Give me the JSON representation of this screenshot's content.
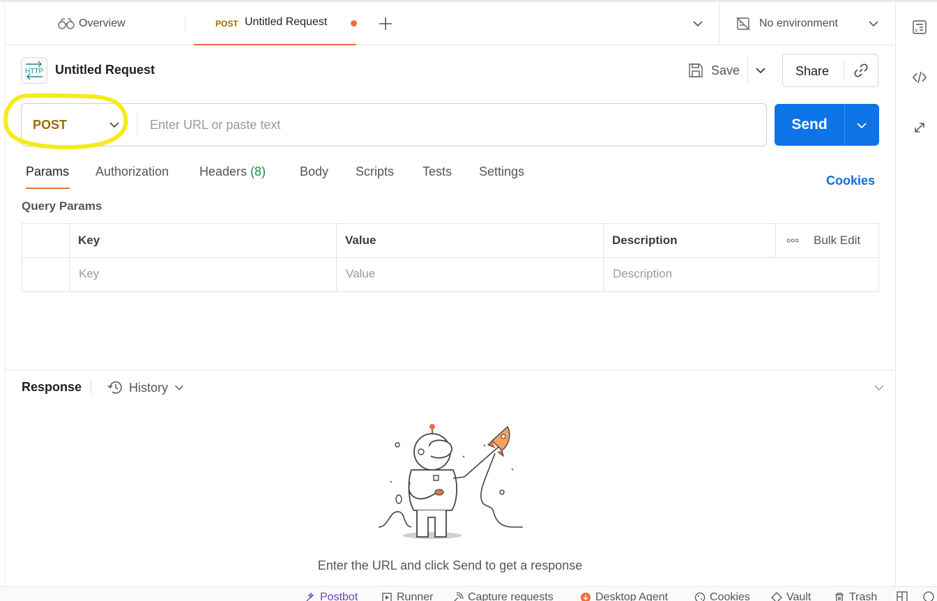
{
  "tabs": {
    "overview_label": "Overview",
    "active": {
      "method": "POST",
      "title": "Untitled Request"
    }
  },
  "environment": {
    "label": "No environment"
  },
  "request": {
    "title": "Untitled Request",
    "save_label": "Save",
    "share_label": "Share",
    "method": "POST",
    "url_placeholder": "Enter URL or paste text",
    "send_label": "Send"
  },
  "request_tabs": {
    "params": "Params",
    "authorization": "Authorization",
    "headers": "Headers",
    "headers_count": "(8)",
    "body": "Body",
    "scripts": "Scripts",
    "tests": "Tests",
    "settings": "Settings",
    "cookies": "Cookies"
  },
  "query_params": {
    "title": "Query Params",
    "columns": {
      "key": "Key",
      "value": "Value",
      "description": "Description"
    },
    "bulk_edit": "Bulk Edit",
    "placeholders": {
      "key": "Key",
      "value": "Value",
      "description": "Description"
    }
  },
  "response": {
    "title": "Response",
    "history_label": "History",
    "empty_message": "Enter the URL and click Send to get a response"
  },
  "statusbar": {
    "items": [
      "Postbot",
      "Runner",
      "Capture requests",
      "Desktop Agent",
      "Cookies",
      "Vault",
      "Trash"
    ]
  },
  "colors": {
    "accent_orange": "#f26b3a",
    "send_blue": "#0d74e7",
    "post_method": "#a06a00",
    "highlight_yellow": "#f5eb1a",
    "headers_count_green": "#1b8a4a"
  },
  "icons": {
    "overview": "binoculars-icon",
    "http": "http-icon",
    "save": "floppy-disk-icon",
    "share_link": "link-icon",
    "environment": "no-environment-icon",
    "rail": [
      "variables-icon",
      "code-icon",
      "arrows-icon"
    ]
  }
}
